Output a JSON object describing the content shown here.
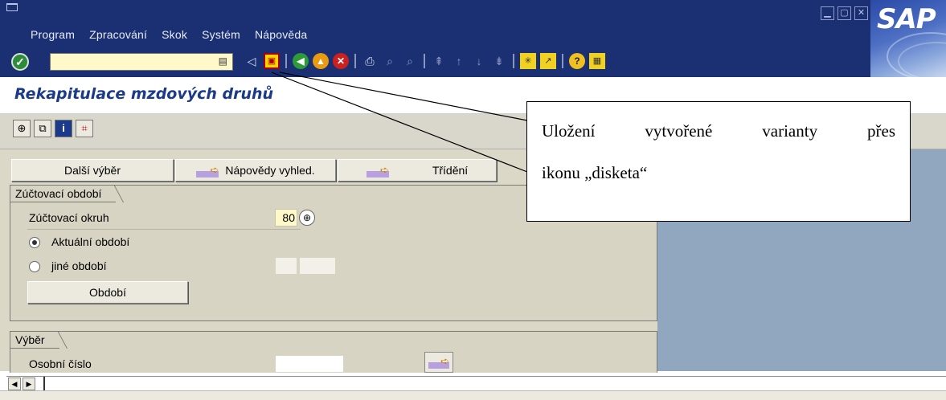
{
  "menubar": {
    "items": [
      "Program",
      "Zpracování",
      "Skok",
      "Systém",
      "Nápověda"
    ]
  },
  "toolbar": {
    "command_value": "",
    "enter_icon": "check-icon",
    "save_icon": "floppy-disk-icon"
  },
  "logo": {
    "text": "SAP"
  },
  "page": {
    "title": "Rekapitulace mzdových druhů"
  },
  "buttons": {
    "dalsi_vyber": "Další výběr",
    "napovedy": "Nápovědy vyhled.",
    "trideni": "Třídění",
    "obdobi": "Období"
  },
  "group_period": {
    "title": "Zúčtovací období",
    "okruh_label": "Zúčtovací okruh",
    "okruh_value": "80",
    "radio_current": "Aktuální období",
    "radio_other": "jiné období"
  },
  "group_selection": {
    "title": "Výběr",
    "personal_number_label": "Osobní číslo"
  },
  "callout": {
    "line1": "Uložení vytvořené varianty přes",
    "line2": "ikonu „disketa“"
  },
  "colors": {
    "menubar": "#1b2f73",
    "workarea": "#dcd8c8",
    "rightpanel": "#91a7c0",
    "title": "#1b3a8a",
    "required_field": "#fff8c8"
  }
}
